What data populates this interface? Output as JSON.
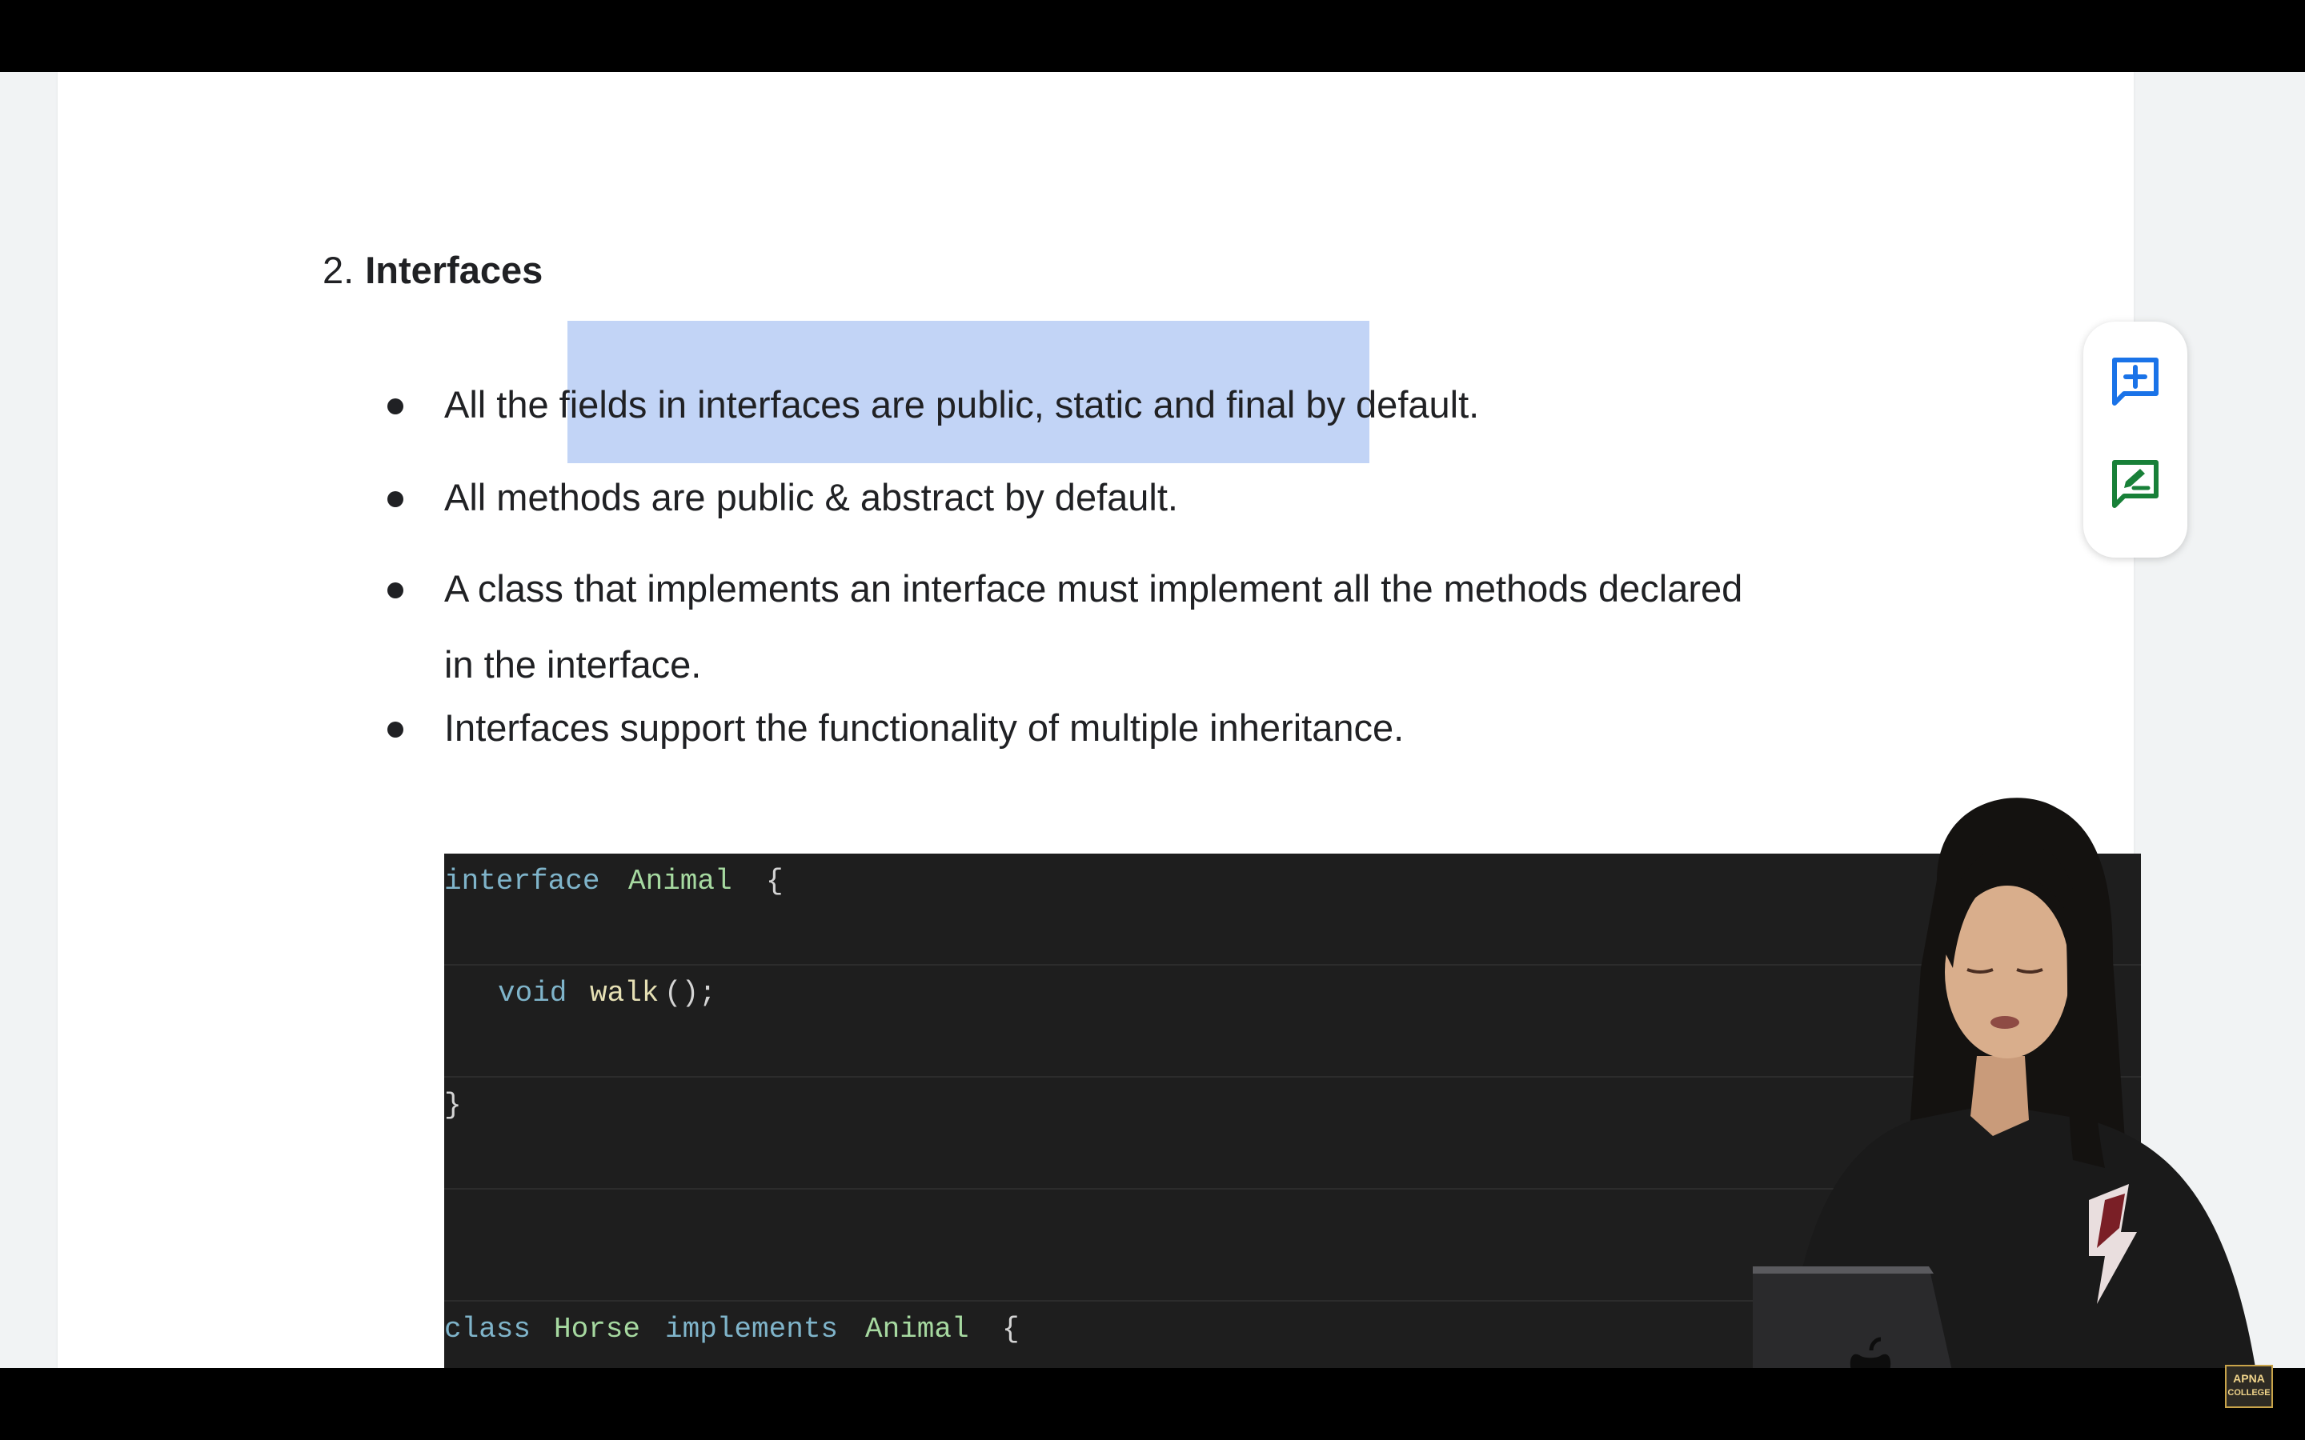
{
  "section": {
    "number": "2.",
    "title": "Interfaces"
  },
  "bullets": [
    {
      "text": "All the fields in interfaces are public, static and final by default."
    },
    {
      "text": "All methods are public & abstract by default."
    },
    {
      "line1": "A class that implements an interface must implement all the methods declared",
      "line2": "in the interface."
    },
    {
      "text": "Interfaces support the functionality of multiple inheritance."
    }
  ],
  "code": {
    "line1": {
      "kw": "interface",
      "ty": "Animal",
      "pu": "{"
    },
    "line2": {
      "kw": "void",
      "fn": "walk",
      "pu": "();"
    },
    "line3": {
      "pu": "}"
    },
    "line5": {
      "kw1": "class",
      "ty1": "Horse",
      "kw2": "implements",
      "ty2": "Animal",
      "pu": "{"
    }
  },
  "side_panel": {
    "icons": [
      "add-comment-icon",
      "suggest-edit-icon"
    ],
    "accent": "#1a73e8",
    "accent2": "#188038"
  },
  "logo": {
    "line1": "APNA",
    "line2": "COLLEGE"
  }
}
